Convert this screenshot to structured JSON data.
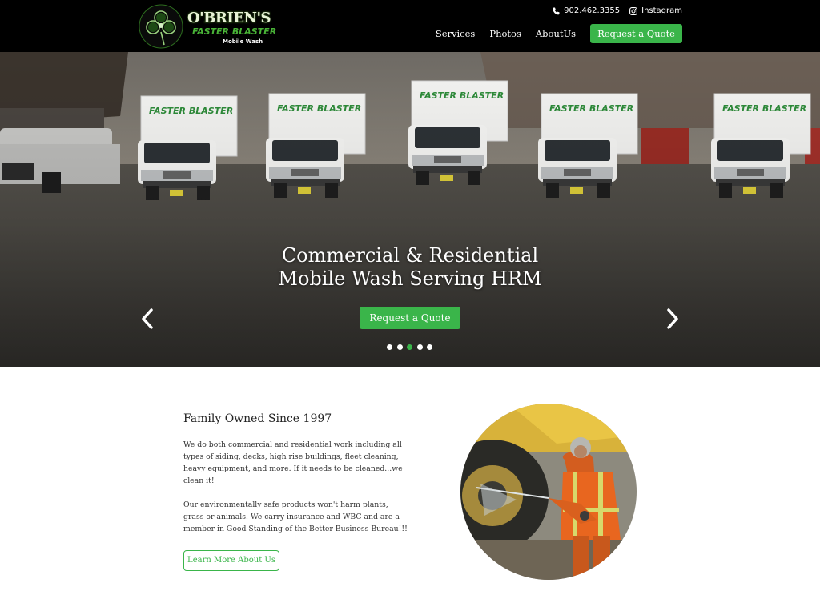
{
  "brand": {
    "name": "O'BRIEN'S",
    "subtitle": "FASTER BLASTER",
    "tagline": "Mobile Wash",
    "green": "#3ab54a"
  },
  "topbar": {
    "phone": "902.462.3355",
    "phone_icon": "phone-icon",
    "social": "Instagram",
    "social_icon": "instagram-icon"
  },
  "nav": {
    "items": [
      "Services",
      "Photos",
      "AboutUs"
    ],
    "cta": "Request a Quote"
  },
  "hero": {
    "title_line1": "Commercial & Residential",
    "title_line2": "Mobile Wash Serving HRM",
    "cta": "Request a Quote",
    "slides": 5,
    "active_slide": 3,
    "prev_icon": "chevron-left-icon",
    "next_icon": "chevron-right-icon",
    "truck_decal": "The FASTER BLASTER"
  },
  "about": {
    "title": "Family Owned Since 1997",
    "paragraph1": "We do both commercial and residential work including all types of siding, decks, high rise buildings, fleet cleaning, heavy equipment, and more. If it needs to be cleaned...we clean it!",
    "paragraph2": "Our environmentally safe products won't harm plants, grass or animals. We carry insurance and WBC and are a member in Good Standing of the Better Business Bureau!!!",
    "button": "Learn More About Us"
  }
}
